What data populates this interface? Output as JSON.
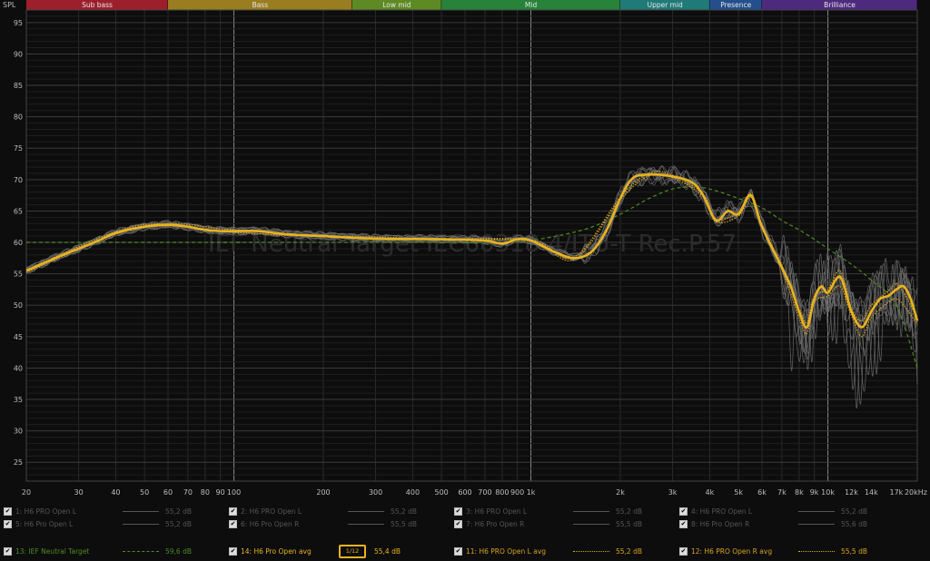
{
  "bands": [
    {
      "label": "Sub bass",
      "from": 20,
      "to": 60,
      "color": "#9e1f2c"
    },
    {
      "label": "Bass",
      "from": 60,
      "to": 250,
      "color": "#9a7d20"
    },
    {
      "label": "Low mid",
      "from": 250,
      "to": 500,
      "color": "#5e8a23"
    },
    {
      "label": "Mid",
      "from": 500,
      "to": 2000,
      "color": "#27833a"
    },
    {
      "label": "Upper mid",
      "from": 2000,
      "to": 4000,
      "color": "#1f7a78"
    },
    {
      "label": "Presence",
      "from": 4000,
      "to": 6000,
      "color": "#244f8c"
    },
    {
      "label": "Brilliance",
      "from": 6000,
      "to": 20000,
      "color": "#4d2a7e"
    }
  ],
  "watermark": "IEF Neutral Target IEC60318-4/ITU-T Rec.P.57",
  "chart_data": {
    "type": "line",
    "ylabel": "SPL",
    "xscale": "log",
    "xlim": [
      20,
      20000
    ],
    "ylim": [
      22,
      97
    ],
    "x_tick_labels": [
      {
        "v": 20,
        "t": "20"
      },
      {
        "v": 30,
        "t": "30"
      },
      {
        "v": 40,
        "t": "40"
      },
      {
        "v": 50,
        "t": "50"
      },
      {
        "v": 60,
        "t": "60"
      },
      {
        "v": 70,
        "t": "70"
      },
      {
        "v": 80,
        "t": "80"
      },
      {
        "v": 90,
        "t": "90"
      },
      {
        "v": 100,
        "t": "100"
      },
      {
        "v": 200,
        "t": "200"
      },
      {
        "v": 300,
        "t": "300"
      },
      {
        "v": 400,
        "t": "400"
      },
      {
        "v": 500,
        "t": "500"
      },
      {
        "v": 600,
        "t": "600"
      },
      {
        "v": 700,
        "t": "700"
      },
      {
        "v": 800,
        "t": "800"
      },
      {
        "v": 900,
        "t": "900"
      },
      {
        "v": 1000,
        "t": "1k"
      },
      {
        "v": 2000,
        "t": "2k"
      },
      {
        "v": 3000,
        "t": "3k"
      },
      {
        "v": 4000,
        "t": "4k"
      },
      {
        "v": 5000,
        "t": "5k"
      },
      {
        "v": 6000,
        "t": "6k"
      },
      {
        "v": 7000,
        "t": "7k"
      },
      {
        "v": 8000,
        "t": "8k"
      },
      {
        "v": 9000,
        "t": "9k"
      },
      {
        "v": 10000,
        "t": "10k"
      },
      {
        "v": 12000,
        "t": "12k"
      },
      {
        "v": 14000,
        "t": "14k"
      },
      {
        "v": 17000,
        "t": "17k"
      },
      {
        "v": 20000,
        "t": "20kHz"
      }
    ],
    "y_ticks": [
      25,
      30,
      35,
      40,
      45,
      50,
      55,
      60,
      65,
      70,
      75,
      80,
      85,
      90,
      95
    ],
    "series": [
      {
        "name": "13: IEF Neutral Target",
        "color": "#4f8a26",
        "style": "dashed",
        "x": [
          20,
          50,
          100,
          200,
          500,
          800,
          1000,
          1500,
          2000,
          2500,
          3000,
          3500,
          4000,
          5000,
          6000,
          7000,
          8000,
          9000,
          10000,
          12000,
          14000,
          17000,
          20000
        ],
        "y": [
          60,
          60,
          60,
          60,
          60,
          60,
          60.3,
          62,
          64.5,
          67,
          68.5,
          68.8,
          68.5,
          67,
          65.5,
          63.5,
          62,
          60.5,
          59,
          56.5,
          54,
          50,
          40
        ]
      },
      {
        "name": "14: H6 Pro Open avg",
        "color": "#e8b320",
        "style": "solid-thick",
        "x": [
          20,
          25,
          30,
          35,
          40,
          50,
          60,
          70,
          80,
          90,
          100,
          120,
          150,
          200,
          300,
          500,
          700,
          800,
          900,
          1000,
          1200,
          1400,
          1600,
          1800,
          2000,
          2200,
          2500,
          3000,
          3500,
          3800,
          4200,
          4600,
          5000,
          5500,
          6000,
          7000,
          7500,
          8000,
          8500,
          9000,
          9500,
          10000,
          11000,
          12000,
          13000,
          14000,
          15000,
          16000,
          17000,
          18000,
          19000,
          20000
        ],
        "y": [
          55.5,
          57.5,
          59,
          60.3,
          61.5,
          62.5,
          62.8,
          62.5,
          62,
          61.8,
          61.8,
          61.8,
          61.3,
          61,
          60.6,
          60.5,
          60.3,
          59.8,
          60.5,
          60.3,
          58.5,
          57.5,
          58.5,
          62,
          67,
          70.2,
          70.8,
          70.5,
          69.5,
          67.5,
          63.5,
          65,
          64.5,
          67.5,
          62.5,
          56,
          53,
          49,
          46.5,
          51,
          53,
          52,
          54.5,
          49,
          46.5,
          49,
          51,
          51.5,
          52.5,
          53,
          51,
          47.5
        ]
      },
      {
        "name": "11: H6 PRO Open L avg",
        "color": "#d9a520",
        "style": "dotted",
        "x": [
          20,
          40,
          60,
          100,
          200,
          500,
          1000,
          1400,
          2000,
          2500,
          3000,
          3800,
          4200,
          5000,
          5500,
          6000,
          7000,
          8000,
          8500,
          9000,
          10000,
          11000,
          12000,
          13000,
          14000,
          16000,
          17000,
          18000,
          20000
        ],
        "y": [
          55.2,
          61.3,
          62.6,
          61.6,
          60.9,
          60.4,
          60.2,
          57.3,
          66.8,
          70.6,
          70.3,
          67.3,
          63.3,
          64.2,
          67.2,
          62.3,
          55.6,
          48,
          45.5,
          50.5,
          51.5,
          53,
          48.3,
          45,
          48,
          50.5,
          51,
          50,
          47
        ]
      },
      {
        "name": "12: H6 PRO Open R avg",
        "color": "#d9a520",
        "style": "dotted",
        "x": [
          20,
          40,
          60,
          100,
          200,
          500,
          1000,
          1400,
          2000,
          2500,
          3000,
          3800,
          4200,
          5000,
          5500,
          6000,
          7000,
          8000,
          8500,
          9000,
          10000,
          11000,
          12000,
          13000,
          14000,
          16000,
          17000,
          18000,
          20000
        ],
        "y": [
          55.6,
          61.7,
          63,
          62,
          61.1,
          60.6,
          60.4,
          57.7,
          67.2,
          71,
          70.7,
          67.7,
          63.7,
          64.8,
          67.8,
          62.7,
          56.4,
          49.5,
          47.3,
          51.5,
          52.5,
          55.5,
          49.5,
          47.5,
          50,
          52.3,
          53.5,
          52,
          48
        ]
      }
    ]
  },
  "legend": [
    {
      "label": "1: H6 PRO Open L",
      "value": "55,2 dB",
      "checked": true,
      "active": false,
      "line": "solid"
    },
    {
      "label": "2: H6 PRO Open L",
      "value": "55,2 dB",
      "checked": true,
      "active": false,
      "line": "solid"
    },
    {
      "label": "3: H6 PRO Open L",
      "value": "55,2 dB",
      "checked": true,
      "active": false,
      "line": "solid"
    },
    {
      "label": "4: H6 PRO Open L",
      "value": "55,2 dB",
      "checked": true,
      "active": false,
      "line": "solid"
    },
    {
      "label": "5: H6 Pro Open L",
      "value": "55,2 dB",
      "checked": true,
      "active": false,
      "line": "solid"
    },
    {
      "label": "6: H6 Pro Open R",
      "value": "55,5 dB",
      "checked": true,
      "active": false,
      "line": "solid"
    },
    {
      "label": "7: H6 Pro Open R",
      "value": "55,5 dB",
      "checked": true,
      "active": false,
      "line": "solid"
    },
    {
      "label": "8: H6 Pro Open R",
      "value": "55,6 dB",
      "checked": true,
      "active": false,
      "line": "solid"
    },
    {
      "label": "9: H6 Pro Open R",
      "value": "55,6 dB",
      "checked": true,
      "active": false,
      "line": "solid"
    },
    {
      "label": "10: H6 Pro Open R",
      "value": "55,5 dB",
      "checked": true,
      "active": false,
      "line": "solid"
    },
    {
      "label": "11: H6 PRO Open L avg",
      "value": "55,2 dB",
      "checked": true,
      "active": true,
      "color": "#d9a520",
      "line": "dotted"
    },
    {
      "label": "12: H6 PRO Open R avg",
      "value": "55,5 dB",
      "checked": true,
      "active": true,
      "color": "#d9a520",
      "line": "dotted"
    },
    {
      "label": "13: IEF Neutral Target",
      "value": "59,6 dB",
      "checked": true,
      "active": true,
      "color": "#4f8a26",
      "line": "dashed"
    },
    {
      "label": "14: H6 Pro Open avg",
      "value": "55,4 dB",
      "checked": true,
      "active": true,
      "color": "#e8b320",
      "line": "badge",
      "badge": "1/12"
    }
  ]
}
